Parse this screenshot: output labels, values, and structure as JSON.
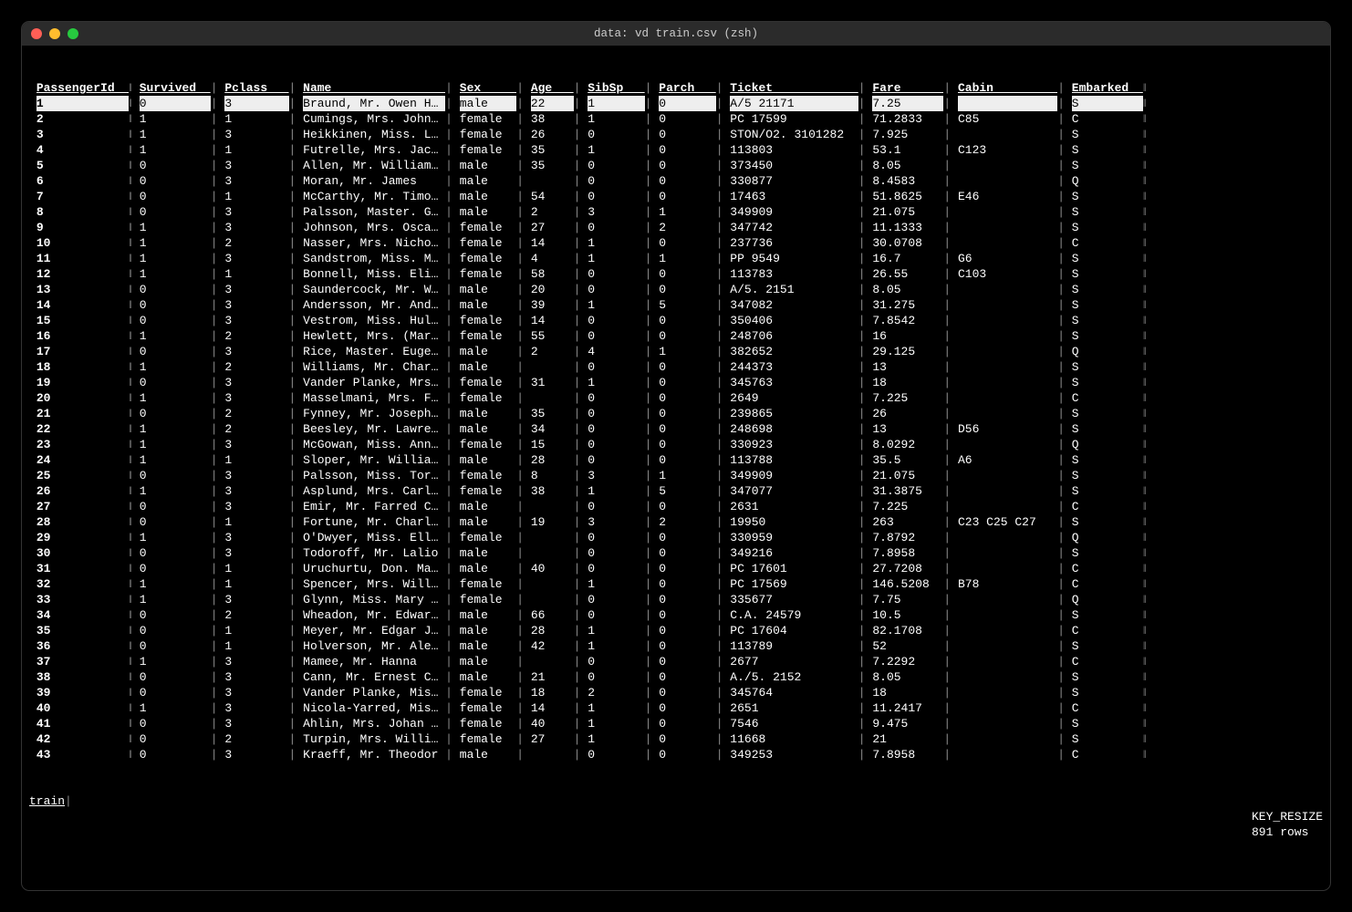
{
  "window": {
    "title": "data: vd train.csv (zsh)"
  },
  "columns": [
    {
      "name": "PassengerId",
      "key": true,
      "width": 13
    },
    {
      "name": "Survived",
      "key": false,
      "width": 10
    },
    {
      "name": "Pclass",
      "key": false,
      "width": 9
    },
    {
      "name": "Name",
      "key": false,
      "width": 20
    },
    {
      "name": "Sex",
      "key": false,
      "width": 8
    },
    {
      "name": "Age",
      "key": false,
      "width": 6
    },
    {
      "name": "SibSp",
      "key": false,
      "width": 8
    },
    {
      "name": "Parch",
      "key": false,
      "width": 8
    },
    {
      "name": "Ticket",
      "key": false,
      "width": 18
    },
    {
      "name": "Fare",
      "key": false,
      "width": 10
    },
    {
      "name": "Cabin",
      "key": false,
      "width": 14
    },
    {
      "name": "Embarked",
      "key": false,
      "width": 10
    }
  ],
  "rows": [
    [
      "1",
      "0",
      "3",
      "Braund, Mr. Owen H…",
      "male",
      "22",
      "1",
      "0",
      "A/5 21171",
      "7.25",
      "",
      "S"
    ],
    [
      "2",
      "1",
      "1",
      "Cumings, Mrs. John…",
      "female",
      "38",
      "1",
      "0",
      "PC 17599",
      "71.2833",
      "C85",
      "C"
    ],
    [
      "3",
      "1",
      "3",
      "Heikkinen, Miss. L…",
      "female",
      "26",
      "0",
      "0",
      "STON/O2. 3101282",
      "7.925",
      "",
      "S"
    ],
    [
      "4",
      "1",
      "1",
      "Futrelle, Mrs. Jac…",
      "female",
      "35",
      "1",
      "0",
      "113803",
      "53.1",
      "C123",
      "S"
    ],
    [
      "5",
      "0",
      "3",
      "Allen, Mr. William…",
      "male",
      "35",
      "0",
      "0",
      "373450",
      "8.05",
      "",
      "S"
    ],
    [
      "6",
      "0",
      "3",
      "Moran, Mr. James",
      "male",
      "",
      "0",
      "0",
      "330877",
      "8.4583",
      "",
      "Q"
    ],
    [
      "7",
      "0",
      "1",
      "McCarthy, Mr. Timo…",
      "male",
      "54",
      "0",
      "0",
      "17463",
      "51.8625",
      "E46",
      "S"
    ],
    [
      "8",
      "0",
      "3",
      "Palsson, Master. G…",
      "male",
      "2",
      "3",
      "1",
      "349909",
      "21.075",
      "",
      "S"
    ],
    [
      "9",
      "1",
      "3",
      "Johnson, Mrs. Osca…",
      "female",
      "27",
      "0",
      "2",
      "347742",
      "11.1333",
      "",
      "S"
    ],
    [
      "10",
      "1",
      "2",
      "Nasser, Mrs. Nicho…",
      "female",
      "14",
      "1",
      "0",
      "237736",
      "30.0708",
      "",
      "C"
    ],
    [
      "11",
      "1",
      "3",
      "Sandstrom, Miss. M…",
      "female",
      "4",
      "1",
      "1",
      "PP 9549",
      "16.7",
      "G6",
      "S"
    ],
    [
      "12",
      "1",
      "1",
      "Bonnell, Miss. Eli…",
      "female",
      "58",
      "0",
      "0",
      "113783",
      "26.55",
      "C103",
      "S"
    ],
    [
      "13",
      "0",
      "3",
      "Saundercock, Mr. W…",
      "male",
      "20",
      "0",
      "0",
      "A/5. 2151",
      "8.05",
      "",
      "S"
    ],
    [
      "14",
      "0",
      "3",
      "Andersson, Mr. And…",
      "male",
      "39",
      "1",
      "5",
      "347082",
      "31.275",
      "",
      "S"
    ],
    [
      "15",
      "0",
      "3",
      "Vestrom, Miss. Hul…",
      "female",
      "14",
      "0",
      "0",
      "350406",
      "7.8542",
      "",
      "S"
    ],
    [
      "16",
      "1",
      "2",
      "Hewlett, Mrs. (Mar…",
      "female",
      "55",
      "0",
      "0",
      "248706",
      "16",
      "",
      "S"
    ],
    [
      "17",
      "0",
      "3",
      "Rice, Master. Euge…",
      "male",
      "2",
      "4",
      "1",
      "382652",
      "29.125",
      "",
      "Q"
    ],
    [
      "18",
      "1",
      "2",
      "Williams, Mr. Char…",
      "male",
      "",
      "0",
      "0",
      "244373",
      "13",
      "",
      "S"
    ],
    [
      "19",
      "0",
      "3",
      "Vander Planke, Mrs…",
      "female",
      "31",
      "1",
      "0",
      "345763",
      "18",
      "",
      "S"
    ],
    [
      "20",
      "1",
      "3",
      "Masselmani, Mrs. F…",
      "female",
      "",
      "0",
      "0",
      "2649",
      "7.225",
      "",
      "C"
    ],
    [
      "21",
      "0",
      "2",
      "Fynney, Mr. Joseph…",
      "male",
      "35",
      "0",
      "0",
      "239865",
      "26",
      "",
      "S"
    ],
    [
      "22",
      "1",
      "2",
      "Beesley, Mr. Lawre…",
      "male",
      "34",
      "0",
      "0",
      "248698",
      "13",
      "D56",
      "S"
    ],
    [
      "23",
      "1",
      "3",
      "McGowan, Miss. Ann…",
      "female",
      "15",
      "0",
      "0",
      "330923",
      "8.0292",
      "",
      "Q"
    ],
    [
      "24",
      "1",
      "1",
      "Sloper, Mr. Willia…",
      "male",
      "28",
      "0",
      "0",
      "113788",
      "35.5",
      "A6",
      "S"
    ],
    [
      "25",
      "0",
      "3",
      "Palsson, Miss. Tor…",
      "female",
      "8",
      "3",
      "1",
      "349909",
      "21.075",
      "",
      "S"
    ],
    [
      "26",
      "1",
      "3",
      "Asplund, Mrs. Carl…",
      "female",
      "38",
      "1",
      "5",
      "347077",
      "31.3875",
      "",
      "S"
    ],
    [
      "27",
      "0",
      "3",
      "Emir, Mr. Farred C…",
      "male",
      "",
      "0",
      "0",
      "2631",
      "7.225",
      "",
      "C"
    ],
    [
      "28",
      "0",
      "1",
      "Fortune, Mr. Charl…",
      "male",
      "19",
      "3",
      "2",
      "19950",
      "263",
      "C23 C25 C27",
      "S"
    ],
    [
      "29",
      "1",
      "3",
      "O'Dwyer, Miss. Ell…",
      "female",
      "",
      "0",
      "0",
      "330959",
      "7.8792",
      "",
      "Q"
    ],
    [
      "30",
      "0",
      "3",
      "Todoroff, Mr. Lalio",
      "male",
      "",
      "0",
      "0",
      "349216",
      "7.8958",
      "",
      "S"
    ],
    [
      "31",
      "0",
      "1",
      "Uruchurtu, Don. Ma…",
      "male",
      "40",
      "0",
      "0",
      "PC 17601",
      "27.7208",
      "",
      "C"
    ],
    [
      "32",
      "1",
      "1",
      "Spencer, Mrs. Will…",
      "female",
      "",
      "1",
      "0",
      "PC 17569",
      "146.5208",
      "B78",
      "C"
    ],
    [
      "33",
      "1",
      "3",
      "Glynn, Miss. Mary …",
      "female",
      "",
      "0",
      "0",
      "335677",
      "7.75",
      "",
      "Q"
    ],
    [
      "34",
      "0",
      "2",
      "Wheadon, Mr. Edwar…",
      "male",
      "66",
      "0",
      "0",
      "C.A. 24579",
      "10.5",
      "",
      "S"
    ],
    [
      "35",
      "0",
      "1",
      "Meyer, Mr. Edgar J…",
      "male",
      "28",
      "1",
      "0",
      "PC 17604",
      "82.1708",
      "",
      "C"
    ],
    [
      "36",
      "0",
      "1",
      "Holverson, Mr. Ale…",
      "male",
      "42",
      "1",
      "0",
      "113789",
      "52",
      "",
      "S"
    ],
    [
      "37",
      "1",
      "3",
      "Mamee, Mr. Hanna",
      "male",
      "",
      "0",
      "0",
      "2677",
      "7.2292",
      "",
      "C"
    ],
    [
      "38",
      "0",
      "3",
      "Cann, Mr. Ernest C…",
      "male",
      "21",
      "0",
      "0",
      "A./5. 2152",
      "8.05",
      "",
      "S"
    ],
    [
      "39",
      "0",
      "3",
      "Vander Planke, Mis…",
      "female",
      "18",
      "2",
      "0",
      "345764",
      "18",
      "",
      "S"
    ],
    [
      "40",
      "1",
      "3",
      "Nicola-Yarred, Mis…",
      "female",
      "14",
      "1",
      "0",
      "2651",
      "11.2417",
      "",
      "C"
    ],
    [
      "41",
      "0",
      "3",
      "Ahlin, Mrs. Johan …",
      "female",
      "40",
      "1",
      "0",
      "7546",
      "9.475",
      "",
      "S"
    ],
    [
      "42",
      "0",
      "2",
      "Turpin, Mrs. Willi…",
      "female",
      "27",
      "1",
      "0",
      "11668",
      "21",
      "",
      "S"
    ],
    [
      "43",
      "0",
      "3",
      "Kraeff, Mr. Theodor",
      "male",
      "",
      "0",
      "0",
      "349253",
      "7.8958",
      "",
      "C"
    ]
  ],
  "selected_row_index": 0,
  "status": {
    "sheet_name": "train",
    "key_msg": "KEY_RESIZE",
    "row_count": "891 rows"
  }
}
